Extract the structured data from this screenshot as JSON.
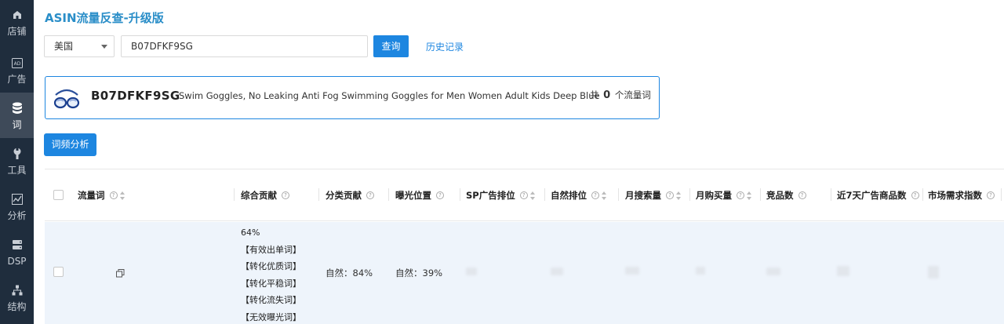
{
  "sidebar": {
    "items": [
      {
        "label": "店铺",
        "icon": "store-icon",
        "active": false
      },
      {
        "label": "广告",
        "icon": "ad-icon",
        "active": false
      },
      {
        "label": "词",
        "icon": "database-icon",
        "active": true
      },
      {
        "label": "工具",
        "icon": "wrench-icon",
        "active": false
      },
      {
        "label": "分析",
        "icon": "chart-icon",
        "active": false
      },
      {
        "label": "DSP",
        "icon": "server-icon",
        "active": false
      },
      {
        "label": "结构",
        "icon": "structure-icon",
        "active": false
      }
    ]
  },
  "page": {
    "title": "ASIN流量反查-升级版"
  },
  "search": {
    "country": "美国",
    "asin_value": "B07DFKF9SG",
    "query_label": "查询",
    "history_label": "历史记录"
  },
  "product": {
    "asin": "B07DFKF9SG",
    "name": "Swim Goggles, No Leaking Anti Fog Swimming Goggles for Men Women Adult Kids Deep Blue",
    "count_prefix": "共",
    "count": "0",
    "count_suffix": "个流量词"
  },
  "analyze_label": "词频分析",
  "table": {
    "columns": [
      {
        "label": "流量词",
        "help": true,
        "sort": true
      },
      {
        "label": "综合贡献",
        "help": true,
        "sort": false
      },
      {
        "label": "分类贡献",
        "help": true,
        "sort": false
      },
      {
        "label": "曝光位置",
        "help": true,
        "sort": false
      },
      {
        "label": "SP广告排位",
        "help": true,
        "sort": true
      },
      {
        "label": "自然排位",
        "help": true,
        "sort": true
      },
      {
        "label": "月搜索量",
        "help": true,
        "sort": true
      },
      {
        "label": "月购买量",
        "help": true,
        "sort": true
      },
      {
        "label": "竞品数",
        "help": true,
        "sort": false
      },
      {
        "label": "近7天广告商品数",
        "help": true,
        "sort": false
      },
      {
        "label": "市场需求指数",
        "help": true,
        "sort": false
      }
    ],
    "rows": [
      {
        "contribution": "64%",
        "tags": [
          "【有效出单词】",
          "【转化优质词】",
          "【转化平稳词】",
          "【转化流失词】",
          "【无效曝光词】"
        ],
        "category_contribution": "自然：84%",
        "exposure_position": "自然：39%"
      }
    ]
  },
  "colors": {
    "accent": "#1d86e0",
    "title": "#2a8ec8",
    "sidebar": "#1f2d3d",
    "row_highlight": "#eef4fb"
  }
}
